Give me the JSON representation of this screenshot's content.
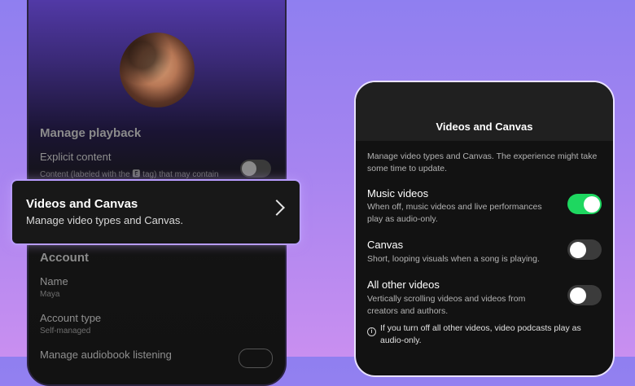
{
  "left_screen": {
    "playback_section": "Manage playback",
    "explicit_title": "Explicit content",
    "explicit_sub": "Content (labeled with the 🅴 tag) that may contain",
    "account_section": "Account",
    "name_label": "Name",
    "name_value": "Maya",
    "account_type_label": "Account type",
    "account_type_value": "Self-managed",
    "audiobook_label": "Manage audiobook listening"
  },
  "highlight_card": {
    "title": "Videos and Canvas",
    "subtitle": "Manage video types and Canvas."
  },
  "right_screen": {
    "title": "Videos and Canvas",
    "intro": "Manage video types and Canvas. The experience might take some time to update.",
    "settings": [
      {
        "title": "Music videos",
        "description": "When off, music videos and live performances play as audio-only.",
        "enabled": true
      },
      {
        "title": "Canvas",
        "description": "Short, looping visuals when a song is playing.",
        "enabled": false
      },
      {
        "title": "All other videos",
        "description": "Vertically scrolling videos and videos from creators and authors.",
        "enabled": false
      }
    ],
    "info_note": "If you turn off all other videos, video podcasts play as audio-only."
  },
  "colors": {
    "toggle_on": "#1ed760",
    "highlight_glow": "#b89cff",
    "background_top": "#8f7ff0",
    "background_bottom": "#c98ff0"
  },
  "icons": [
    "profile-avatar",
    "chevron-right-icon",
    "info-icon"
  ]
}
